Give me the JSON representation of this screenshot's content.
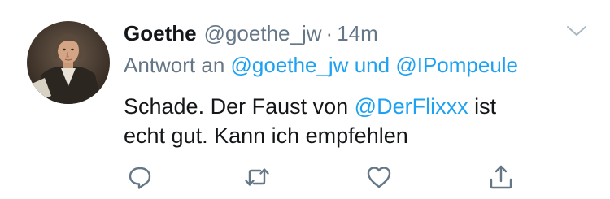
{
  "tweet": {
    "author_name": "Goethe",
    "author_handle": "@goethe_jw",
    "separator": "·",
    "time": "14m",
    "reply_prefix": "Antwort an",
    "reply_to_1": "@goethe_jw",
    "reply_connector": "und",
    "reply_to_2": "@IPompeule",
    "text_part1": "Schade. Der Faust von",
    "text_mention": "@DerFlixxx",
    "text_part2": "ist",
    "text_line2": "echt gut. Kann ich empfehlen"
  },
  "icons": {
    "menu": "chevron-down-icon",
    "reply": "reply-icon",
    "retweet": "retweet-icon",
    "like": "heart-icon",
    "share": "share-icon"
  },
  "colors": {
    "text": "#14171a",
    "muted": "#657786",
    "link": "#1da1f2"
  }
}
